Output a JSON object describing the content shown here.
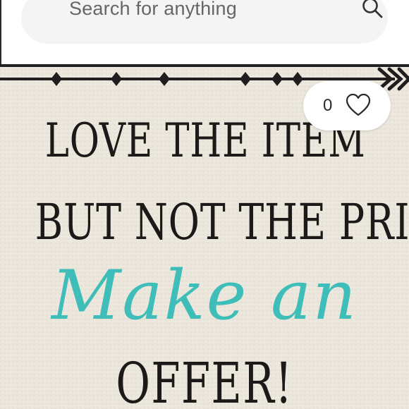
{
  "search": {
    "placeholder": "Search for anything"
  },
  "listing": {
    "sign_lines": [
      "LOVE THE ITEM",
      "BUT NOT THE PRICE",
      "Make an",
      "OFFER!"
    ],
    "like_count": "0"
  },
  "icons": {
    "search": "search-icon",
    "like": "heart-outline-icon"
  },
  "colors": {
    "sign_text": "#1c1a18",
    "script_accent": "#3fbdb8",
    "sign_background": "#ece7dd",
    "search_bar": "#f4f4f4"
  }
}
